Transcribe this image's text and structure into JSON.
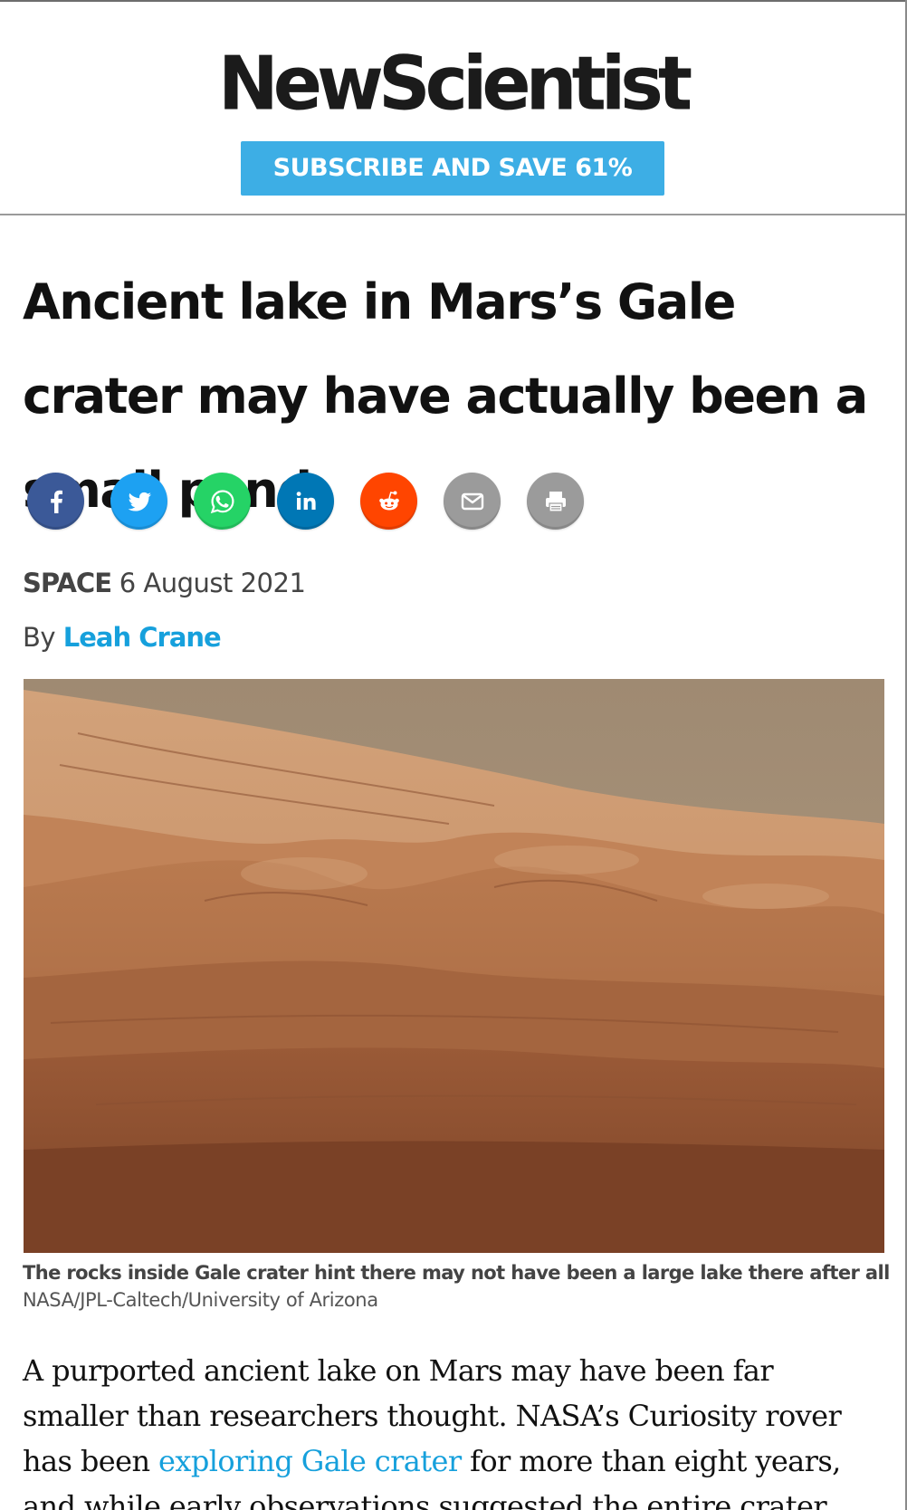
{
  "header": {
    "logo_text": "NewScientist",
    "subscribe_label": "SUBSCRIBE AND SAVE 61%"
  },
  "article": {
    "title": "Ancient lake in Mars’s Gale crater may have actually been a small pond",
    "section": "SPACE",
    "date": "6 August 2021",
    "byline_prefix": "By",
    "author": "Leah Crane",
    "caption": "The rocks inside Gale crater hint there may not have been a large lake there after all",
    "credit": "NASA/JPL-Caltech/University of Arizona",
    "body": {
      "text_1": "A purported ancient lake on Mars may have been far smaller than researchers thought. NASA’s Curiosity rover has been ",
      "link_text": "exploring Gale crater",
      "text_2": " for more than eight years, and while early observations suggested the entire crater may once have"
    }
  },
  "share": [
    {
      "name": "facebook",
      "icon": "facebook-icon",
      "color": "#3b5998"
    },
    {
      "name": "twitter",
      "icon": "twitter-icon",
      "color": "#1da1f2"
    },
    {
      "name": "whatsapp",
      "icon": "whatsapp-icon",
      "color": "#25d366"
    },
    {
      "name": "linkedin",
      "icon": "linkedin-icon",
      "color": "#0077b5"
    },
    {
      "name": "reddit",
      "icon": "reddit-icon",
      "color": "#ff4500"
    },
    {
      "name": "email",
      "icon": "email-icon",
      "color": "#999999"
    },
    {
      "name": "print",
      "icon": "print-icon",
      "color": "#999999"
    }
  ],
  "colors": {
    "accent": "#3daee5",
    "link": "#16a0dc",
    "text": "#111111",
    "meta": "#444444"
  }
}
